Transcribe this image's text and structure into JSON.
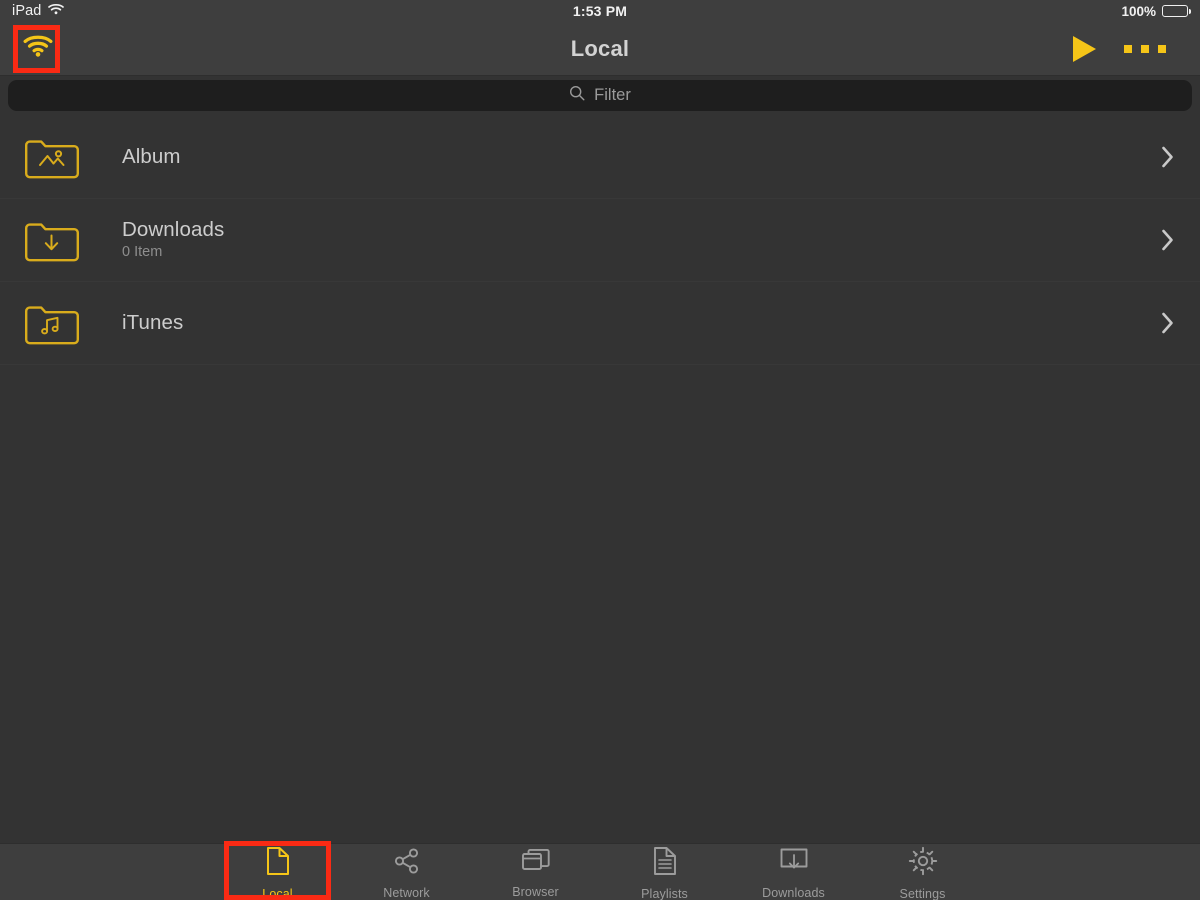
{
  "status_bar": {
    "device_label": "iPad",
    "wifi_icon": "wifi-icon",
    "time": "1:53 PM",
    "battery_percent": "100%",
    "battery_icon": "battery-full-icon"
  },
  "nav_bar": {
    "wifi_button_icon": "wifi-icon",
    "title": "Local",
    "play_button_icon": "play-icon",
    "more_button_icon": "more-horizontal-icon"
  },
  "filter": {
    "search_icon": "search-icon",
    "placeholder": "Filter",
    "value": ""
  },
  "list": {
    "rows": [
      {
        "title": "Album",
        "subtitle": "",
        "icon": "folder-photos-icon",
        "chevron": "chevron-right-icon"
      },
      {
        "title": "Downloads",
        "subtitle": "0 Item",
        "icon": "folder-download-icon",
        "chevron": "chevron-right-icon"
      },
      {
        "title": "iTunes",
        "subtitle": "",
        "icon": "folder-music-icon",
        "chevron": "chevron-right-icon"
      }
    ]
  },
  "tab_bar": {
    "tabs": [
      {
        "label": "Local",
        "icon": "document-icon",
        "active": true
      },
      {
        "label": "Network",
        "icon": "share-icon",
        "active": false
      },
      {
        "label": "Browser",
        "icon": "windows-icon",
        "active": false
      },
      {
        "label": "Playlists",
        "icon": "playlist-icon",
        "active": false
      },
      {
        "label": "Downloads",
        "icon": "download-box-icon",
        "active": false
      },
      {
        "label": "Settings",
        "icon": "gear-icon",
        "active": false
      }
    ]
  },
  "highlights": [
    {
      "target": "nav-wifi-button"
    },
    {
      "target": "tab-local"
    }
  ],
  "colors": {
    "accent": "#f5c518",
    "background": "#333333",
    "bar_background": "#3e3e3e",
    "filter_background": "#1e1e1e",
    "primary_text": "#cdcdcd",
    "secondary_text": "#8e8e8e",
    "highlight": "#fa2a14"
  }
}
